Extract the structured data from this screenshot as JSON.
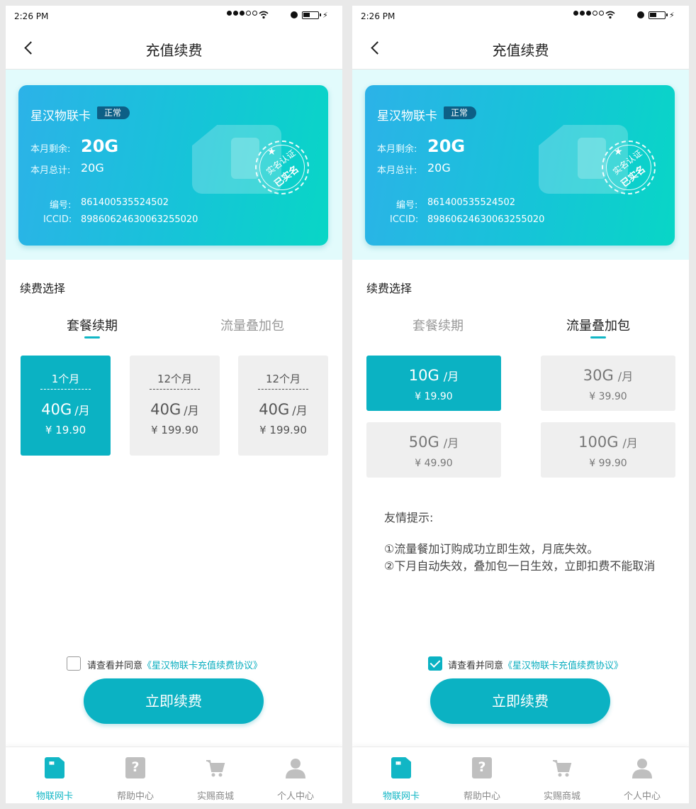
{
  "screens": [
    {
      "status": {
        "time": "2:26 PM"
      },
      "nav": {
        "title": "充值续费"
      },
      "card": {
        "name": "星汉物联卡",
        "badge": "正常",
        "remain_label": "本月剩余:",
        "remain_value": "20G",
        "total_label": "本月总计:",
        "total_value": "20G",
        "serial_label": "编号:",
        "serial_value": "861400535524502",
        "iccid_label": "ICCID:",
        "iccid_value": "89860624630063255020",
        "seal_line1": "实名认证",
        "seal_line2": "已实名"
      },
      "section_title": "续费选择",
      "tabs": [
        {
          "label": "套餐续期"
        },
        {
          "label": "流量叠加包"
        }
      ],
      "active_tab": 0,
      "plans": [
        {
          "duration": "1个月",
          "amount": "40G",
          "unit": "/月",
          "price": "¥ 19.90",
          "selected": true
        },
        {
          "duration": "12个月",
          "amount": "40G",
          "unit": "/月",
          "price": "¥ 199.90",
          "selected": false
        },
        {
          "duration": "12个月",
          "amount": "40G",
          "unit": "/月",
          "price": "¥ 199.90",
          "selected": false
        }
      ],
      "agree": {
        "text": "请查看并同意",
        "link": "《星汉物联卡充值续费协议》",
        "checked": false
      },
      "cta": "立即续费",
      "tabbar": [
        {
          "label": "物联网卡"
        },
        {
          "label": "帮助中心"
        },
        {
          "label": "实赐商城"
        },
        {
          "label": "个人中心"
        }
      ]
    },
    {
      "status": {
        "time": "2:26 PM"
      },
      "nav": {
        "title": "充值续费"
      },
      "card": {
        "name": "星汉物联卡",
        "badge": "正常",
        "remain_label": "本月剩余:",
        "remain_value": "20G",
        "total_label": "本月总计:",
        "total_value": "20G",
        "serial_label": "编号:",
        "serial_value": "861400535524502",
        "iccid_label": "ICCID:",
        "iccid_value": "89860624630063255020",
        "seal_line1": "实名认证",
        "seal_line2": "已实名"
      },
      "section_title": "续费选择",
      "tabs": [
        {
          "label": "套餐续期"
        },
        {
          "label": "流量叠加包"
        }
      ],
      "active_tab": 1,
      "packs": [
        {
          "amount": "10G",
          "unit": "/月",
          "price": "¥ 19.90",
          "selected": true
        },
        {
          "amount": "30G",
          "unit": "/月",
          "price": "¥ 39.90",
          "selected": false
        },
        {
          "amount": "50G",
          "unit": "/月",
          "price": "¥ 49.90",
          "selected": false
        },
        {
          "amount": "100G",
          "unit": "/月",
          "price": "¥ 99.90",
          "selected": false
        }
      ],
      "tips": {
        "title": "友情提示:",
        "line1": "①流量餐加订购成功立即生效，月底失效。",
        "line2": "②下月自动失效，叠加包一日生效，立即扣费不能取消"
      },
      "agree": {
        "text": "请查看并同意",
        "link": "《星汉物联卡充值续费协议》",
        "checked": true
      },
      "cta": "立即续费",
      "tabbar": [
        {
          "label": "物联网卡"
        },
        {
          "label": "帮助中心"
        },
        {
          "label": "实赐商城"
        },
        {
          "label": "个人中心"
        }
      ]
    }
  ],
  "colors": {
    "accent": "#0bb2c3",
    "badge": "#0d5f86",
    "card_bg_start": "#2cb2e8",
    "card_bg_end": "#08d6c6",
    "header_band": "#e2fbfc"
  }
}
